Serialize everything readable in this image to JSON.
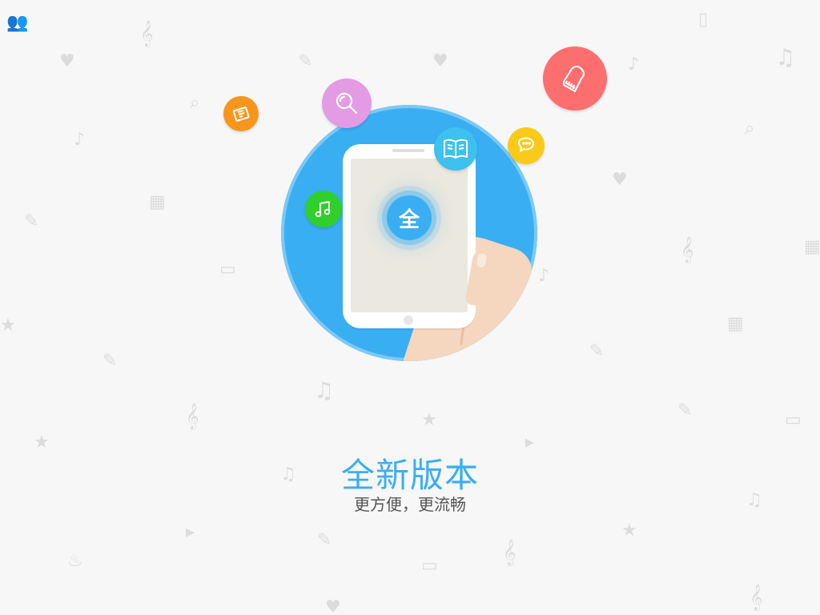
{
  "splash": {
    "center_badge": "全",
    "headline": "全新版本",
    "subline": "更方便，更流畅"
  },
  "bubbles": [
    {
      "name": "piano-icon",
      "color": "#fd6f6f"
    },
    {
      "name": "search-icon",
      "color": "#e39be4"
    },
    {
      "name": "book-icon",
      "color": "#3ec1ee"
    },
    {
      "name": "chat-icon",
      "color": "#f8cb1b"
    },
    {
      "name": "list-icon",
      "color": "#f7961d"
    },
    {
      "name": "music-note-icon",
      "color": "#30cf2c"
    }
  ],
  "colors": {
    "accent": "#3aaef2",
    "background": "#f7f7f7"
  }
}
